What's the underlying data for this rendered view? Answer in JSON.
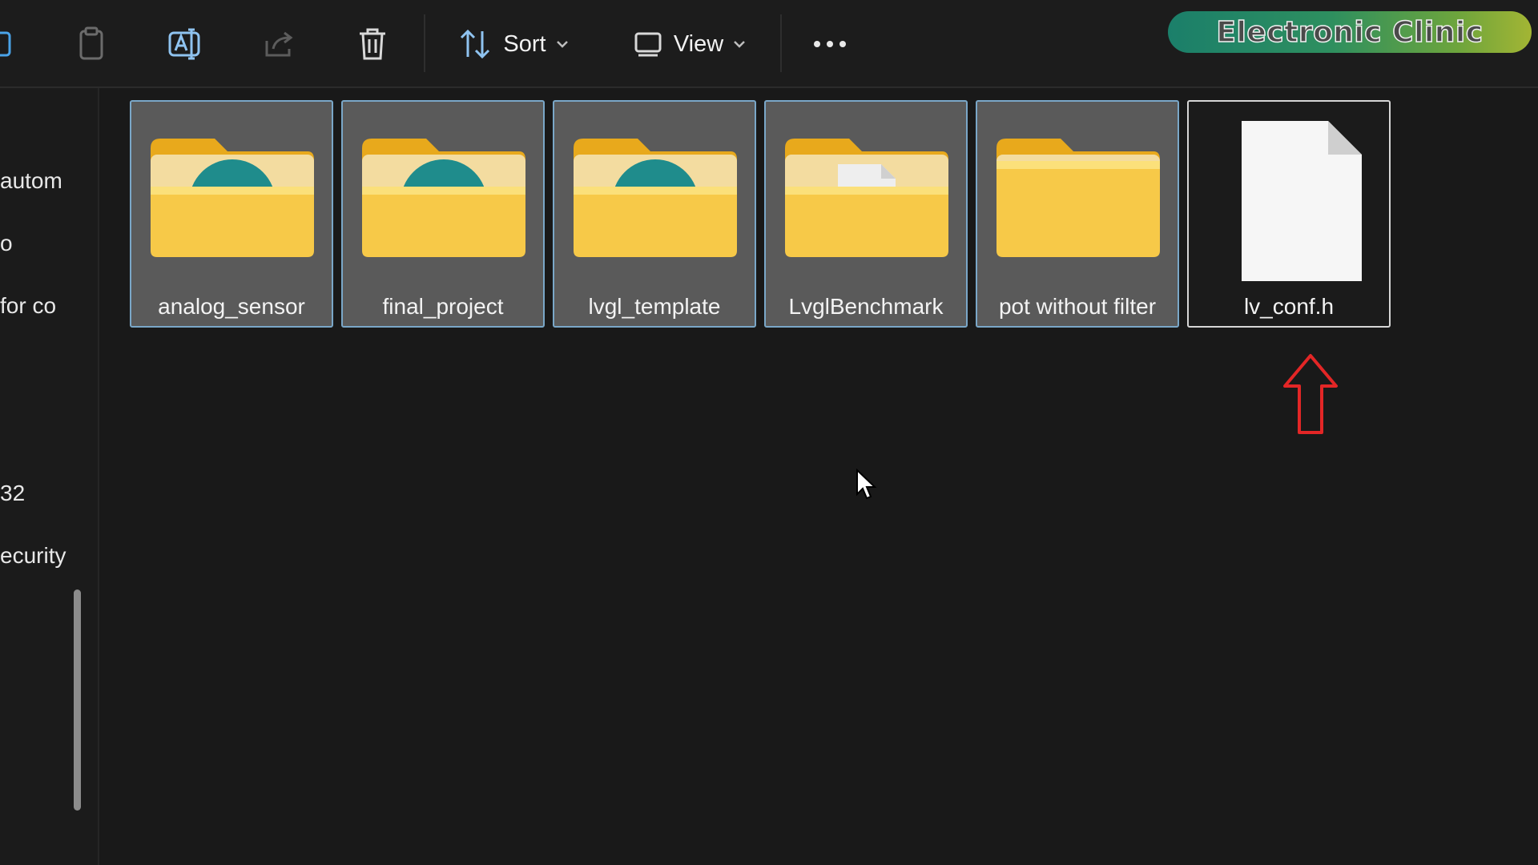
{
  "toolbar": {
    "sort_label": "Sort",
    "view_label": "View"
  },
  "watermark": {
    "text": "Electronic Clinic"
  },
  "sidebar": {
    "items": [
      {
        "label": "autom"
      },
      {
        "label": "o"
      },
      {
        "label": "for co"
      },
      {
        "label": "32"
      },
      {
        "label": "ecurity"
      }
    ]
  },
  "files": [
    {
      "name": "analog_sensor",
      "kind": "folder",
      "overlay": "arduino-logo",
      "selected": true
    },
    {
      "name": "final_project",
      "kind": "folder",
      "overlay": "arduino-logo",
      "selected": true
    },
    {
      "name": "lvgl_template",
      "kind": "folder",
      "overlay": "arduino-logo",
      "selected": true
    },
    {
      "name": "LvglBenchmark",
      "kind": "folder",
      "overlay": "document",
      "selected": true
    },
    {
      "name": "pot without filter",
      "kind": "folder",
      "overlay": "none",
      "selected": true
    },
    {
      "name": "lv_conf.h",
      "kind": "file",
      "overlay": "none",
      "selected": false
    }
  ],
  "colors": {
    "background": "#191919",
    "selection_fill": "#5a5a5a",
    "selection_border": "#7aa7c8",
    "folder_yellow": "#f7c948",
    "arduino_teal": "#1f8c8c",
    "annotation_red": "#e32626"
  }
}
